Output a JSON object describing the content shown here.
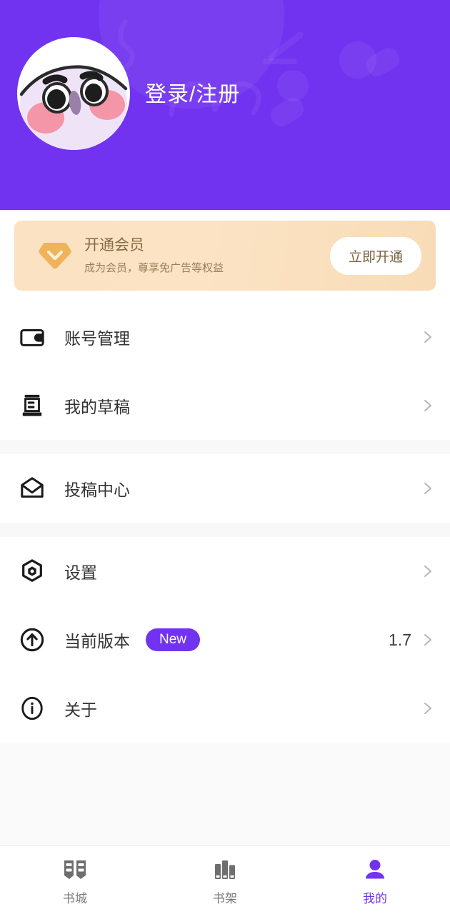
{
  "header": {
    "login_text": "登录/注册",
    "bg_color": "#7233f0",
    "avatar_icon": "cartoon-character-avatar"
  },
  "vip_banner": {
    "icon": "diamond-gem-icon",
    "title": "开通会员",
    "subtitle": "成为会员，尊享免广告等权益",
    "button_label": "立即开通",
    "bg_color": "#fae2c2"
  },
  "menu": {
    "groups": [
      {
        "items": [
          {
            "icon": "wallet-icon",
            "label": "账号管理",
            "value": "",
            "badge": ""
          },
          {
            "icon": "draft-document-icon",
            "label": "我的草稿",
            "value": "",
            "badge": ""
          }
        ]
      },
      {
        "items": [
          {
            "icon": "envelope-open-icon",
            "label": "投稿中心",
            "value": "",
            "badge": ""
          }
        ]
      },
      {
        "items": [
          {
            "icon": "gear-hexagon-icon",
            "label": "设置",
            "value": "",
            "badge": ""
          },
          {
            "icon": "arrow-up-circle-icon",
            "label": "当前版本",
            "value": "1.7",
            "badge": "New"
          },
          {
            "icon": "info-circle-icon",
            "label": "关于",
            "value": "",
            "badge": ""
          }
        ]
      }
    ],
    "chevron_icon": "chevron-right-icon",
    "badge_color": "#7233f0"
  },
  "bottom_nav": {
    "active_color": "#7233f0",
    "inactive_color": "#7a7a7a",
    "items": [
      {
        "icon": "open-book-icon",
        "label": "书城",
        "active": false
      },
      {
        "icon": "bookshelf-icon",
        "label": "书架",
        "active": false
      },
      {
        "icon": "person-icon",
        "label": "我的",
        "active": true
      }
    ]
  }
}
